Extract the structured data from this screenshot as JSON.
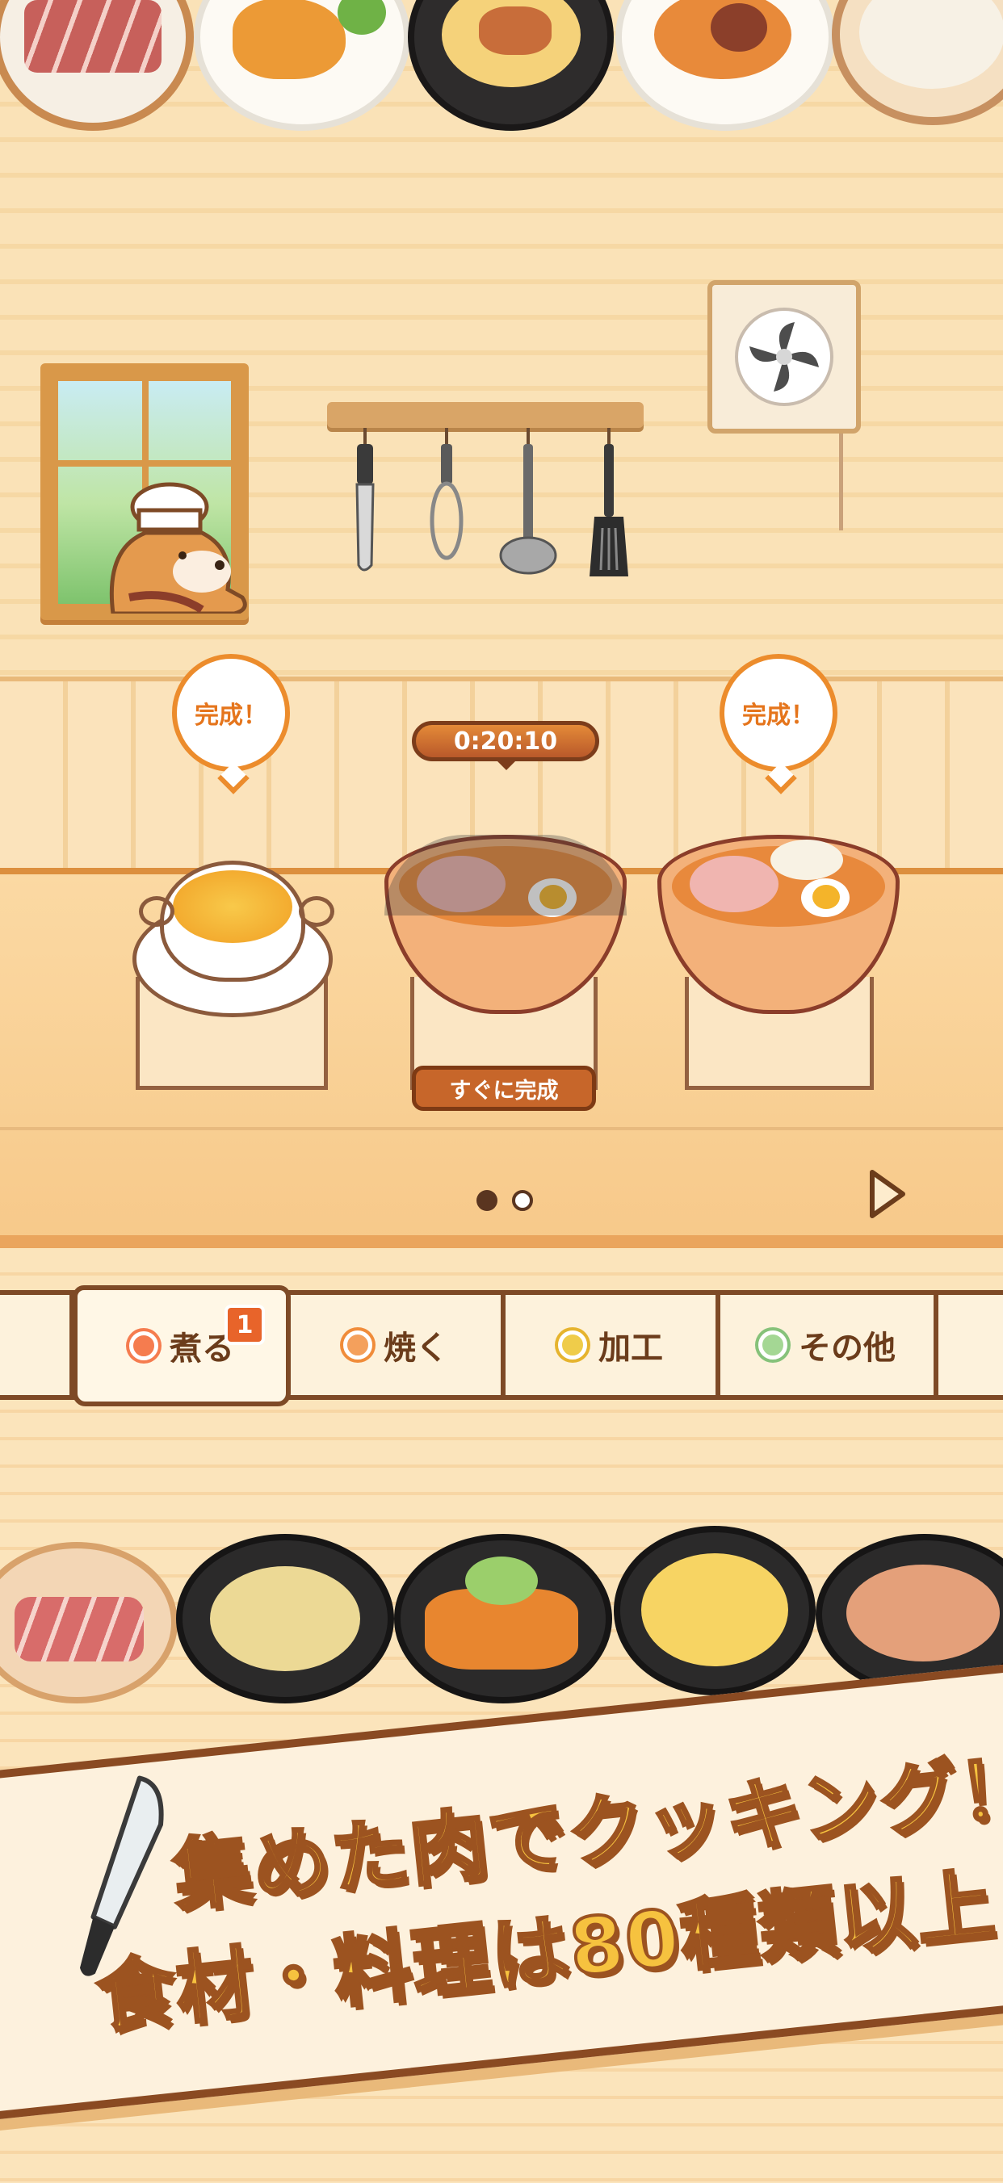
{
  "colors": {
    "accent_orange": "#ec8c2c",
    "outline_brown": "#7e4a26",
    "banner_text": "#f6c23f"
  },
  "cooking": {
    "slots": [
      {
        "status_label": "完成！",
        "dish": "consomme-soup"
      },
      {
        "timer": "0:20:10",
        "finish_now_label": "すぐに完成",
        "dish": "ramen"
      },
      {
        "status_label": "完成！",
        "dish": "ramen"
      }
    ]
  },
  "pagination": {
    "pages": 2,
    "current": 1
  },
  "tabs": [
    {
      "label": "",
      "partial": true
    },
    {
      "label": "煮る",
      "active": true,
      "badge": "1",
      "icon_color": "#ec6a3a"
    },
    {
      "label": "焼く",
      "icon_color": "#f08c3a"
    },
    {
      "label": "加工",
      "icon_color": "#e6b42e"
    },
    {
      "label": "その他",
      "icon_color": "#86c27a"
    }
  ],
  "banner": {
    "line1": "集めた肉でクッキング！",
    "line2": "食材・料理は80種類以上"
  }
}
